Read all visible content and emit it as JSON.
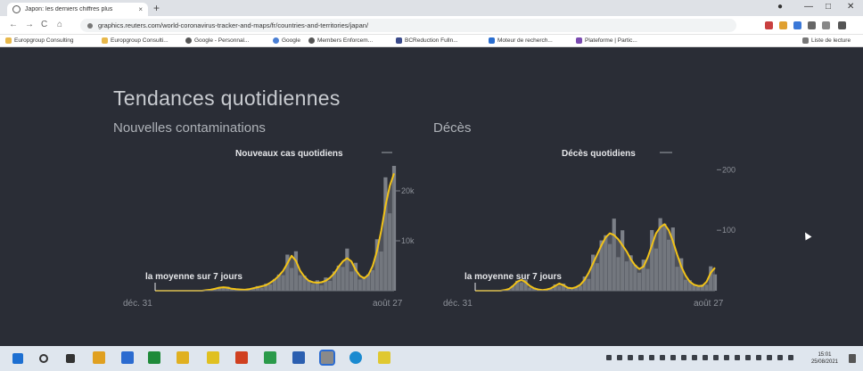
{
  "browser": {
    "tab_title": "Japon: les derniers chiffres plus",
    "tab_close": "×",
    "new_tab": "+",
    "url": "graphics.reuters.com/world-coronavirus-tracker-and-maps/fr/countries-and-territories/japan/",
    "nav_back": "←",
    "nav_forward": "→",
    "nav_reload": "C",
    "nav_home": "⌂",
    "win_min": "—",
    "win_max": "□",
    "win_close": "✕",
    "bookmarks": [
      "Europgroup Consulting",
      "Europgroup Consulti...",
      "Google - Personnal...",
      "Google",
      "Members Enforcem...",
      "BCReduction Fulln...",
      "Moteur de recherch...",
      "Plateforme | Partic..."
    ],
    "reading_list": "Liste de lecture"
  },
  "page": {
    "title": "Tendances quotidiennes",
    "left_chart_title": "Nouvelles contaminations",
    "right_chart_title": "Décès"
  },
  "chart_data": [
    {
      "type": "area",
      "title": "Nouvelles contaminations",
      "x_start": "déc. 31",
      "x_end": "août 27",
      "y_ticks": [
        "10k",
        "20k"
      ],
      "annotation_top": "Nouveaux cas quotidiens",
      "annotation_avg": "la moyenne sur 7 jours",
      "ylim": [
        0,
        25000
      ],
      "series": [
        {
          "name": "Nouveaux cas quotidiens",
          "values": [
            0,
            0,
            0,
            0,
            0,
            0,
            0,
            0,
            0,
            0,
            0,
            0,
            100,
            200,
            400,
            600,
            700,
            600,
            400,
            300,
            250,
            200,
            300,
            500,
            700,
            900,
            1100,
            1600,
            2200,
            3000,
            4000,
            5500,
            7000,
            6000,
            4000,
            2800,
            2000,
            1700,
            1600,
            1700,
            2000,
            2600,
            3500,
            4800,
            5900,
            6500,
            5900,
            4200,
            3000,
            2500,
            3200,
            5000,
            8000,
            12000,
            17000,
            21000,
            23500
          ]
        }
      ]
    },
    {
      "type": "area",
      "title": "Décès",
      "x_start": "déc. 31",
      "x_end": "août 27",
      "y_ticks": [
        "100",
        "200"
      ],
      "annotation_top": "Décès quotidiens",
      "annotation_avg": "la moyenne sur 7 jours",
      "ylim": [
        0,
        230
      ],
      "series": [
        {
          "name": "Décès quotidiens",
          "values": [
            0,
            0,
            0,
            0,
            0,
            0,
            0,
            1,
            3,
            8,
            15,
            18,
            14,
            8,
            4,
            2,
            1,
            2,
            4,
            8,
            12,
            9,
            5,
            4,
            6,
            10,
            18,
            30,
            45,
            60,
            75,
            88,
            95,
            92,
            85,
            75,
            65,
            52,
            42,
            36,
            40,
            55,
            75,
            95,
            105,
            110,
            100,
            82,
            60,
            40,
            25,
            15,
            10,
            8,
            8,
            15,
            30,
            38
          ]
        }
      ]
    }
  ],
  "taskbar": {
    "time": "15:01",
    "date": "25/08/2021"
  }
}
